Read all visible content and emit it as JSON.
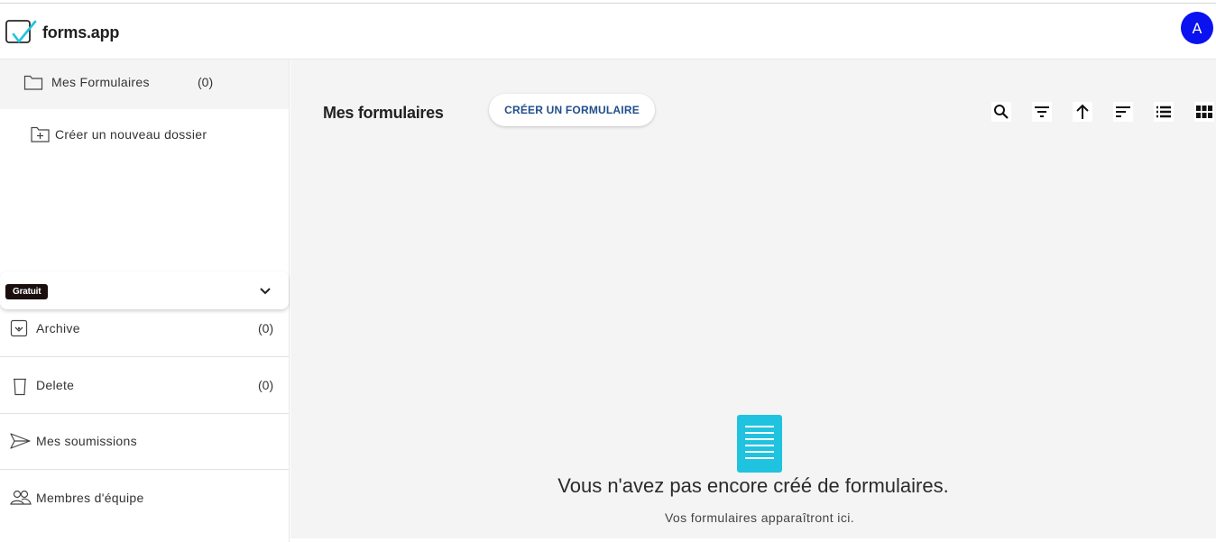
{
  "app": {
    "name": "forms.app",
    "avatar_initial": "A",
    "avatar_color": "#0a12f0"
  },
  "sidebar": {
    "folder": {
      "label": "Mes Formulaires",
      "count": "(0)"
    },
    "new_folder_label": "Créer un nouveau dossier",
    "plan_badge": "Gratuit",
    "items": [
      {
        "label": "Archive",
        "count": "(0)",
        "icon": "archive-icon"
      },
      {
        "label": "Delete",
        "count": "(0)",
        "icon": "trash-icon"
      },
      {
        "label": "Mes soumissions",
        "count": "",
        "icon": "send-icon"
      },
      {
        "label": "Membres d'équipe",
        "count": "",
        "icon": "team-icon"
      }
    ]
  },
  "main": {
    "title": "Mes formulaires",
    "create_button": "CRÉER UN FORMULAIRE",
    "tools": [
      "search-icon",
      "filter-icon",
      "sort-direction-icon",
      "sort-icon",
      "list-view-icon",
      "grid-view-icon"
    ],
    "empty_title": "Vous n'avez pas encore créé de formulaires.",
    "empty_subtitle": "Vos formulaires apparaîtront ici.",
    "empty_icon_color": "#1fc3df"
  }
}
